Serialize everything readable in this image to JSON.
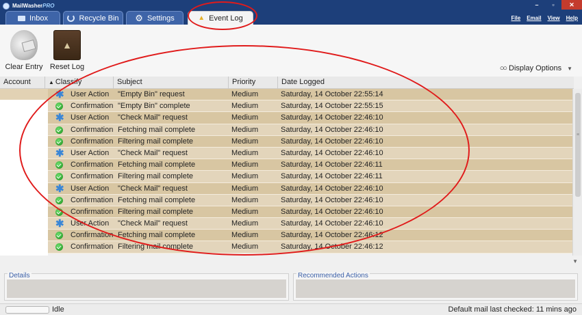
{
  "app": {
    "title_main": "MailWasher",
    "title_suffix": "PRO"
  },
  "window_controls": {
    "minimize": "–",
    "maximize": "▫",
    "close": "✕"
  },
  "tabs": [
    {
      "label": "Inbox",
      "icon": "inbox-icon"
    },
    {
      "label": "Recycle Bin",
      "icon": "recycle-bin-icon"
    },
    {
      "label": "Settings",
      "icon": "gear-icon"
    },
    {
      "label": "Event Log",
      "icon": "warning-icon",
      "active": true
    }
  ],
  "menu": {
    "file": "File",
    "email": "Email",
    "view": "View",
    "help": "Help"
  },
  "toolbar": {
    "clear_entry": "Clear Entry",
    "reset_log": "Reset Log",
    "display_options": "Display Options"
  },
  "columns": {
    "account": "Account",
    "classify": "Classify",
    "subject": "Subject",
    "priority": "Priority",
    "date_logged": "Date Logged"
  },
  "log_rows": [
    {
      "icon": "star",
      "classify": "User Action",
      "subject": "\"Empty Bin\" request",
      "priority": "Medium",
      "date": "Saturday, 14 October 22:55:14"
    },
    {
      "icon": "check",
      "classify": "Confirmation",
      "subject": "\"Empty Bin\" complete",
      "priority": "Medium",
      "date": "Saturday, 14 October 22:55:15"
    },
    {
      "icon": "star",
      "classify": "User Action",
      "subject": "\"Check Mail\" request",
      "priority": "Medium",
      "date": "Saturday, 14 October 22:46:10"
    },
    {
      "icon": "check",
      "classify": "Confirmation",
      "subject": "Fetching mail complete",
      "priority": "Medium",
      "date": "Saturday, 14 October 22:46:10"
    },
    {
      "icon": "check",
      "classify": "Confirmation",
      "subject": "Filtering mail complete",
      "priority": "Medium",
      "date": "Saturday, 14 October 22:46:10"
    },
    {
      "icon": "star",
      "classify": "User Action",
      "subject": "\"Check Mail\" request",
      "priority": "Medium",
      "date": "Saturday, 14 October 22:46:10"
    },
    {
      "icon": "check",
      "classify": "Confirmation",
      "subject": "Fetching mail complete",
      "priority": "Medium",
      "date": "Saturday, 14 October 22:46:11"
    },
    {
      "icon": "check",
      "classify": "Confirmation",
      "subject": "Filtering mail complete",
      "priority": "Medium",
      "date": "Saturday, 14 October 22:46:11"
    },
    {
      "icon": "star",
      "classify": "User Action",
      "subject": "\"Check Mail\" request",
      "priority": "Medium",
      "date": "Saturday, 14 October 22:46:10"
    },
    {
      "icon": "check",
      "classify": "Confirmation",
      "subject": "Fetching mail complete",
      "priority": "Medium",
      "date": "Saturday, 14 October 22:46:10"
    },
    {
      "icon": "check",
      "classify": "Confirmation",
      "subject": "Filtering mail complete",
      "priority": "Medium",
      "date": "Saturday, 14 October 22:46:10"
    },
    {
      "icon": "star",
      "classify": "User Action",
      "subject": "\"Check Mail\" request",
      "priority": "Medium",
      "date": "Saturday, 14 October 22:46:10"
    },
    {
      "icon": "check",
      "classify": "Confirmation",
      "subject": "Fetching mail complete",
      "priority": "Medium",
      "date": "Saturday, 14 October 22:46:12"
    },
    {
      "icon": "check",
      "classify": "Confirmation",
      "subject": "Filtering mail complete",
      "priority": "Medium",
      "date": "Saturday, 14 October 22:46:12"
    }
  ],
  "panes": {
    "details": "Details",
    "recommended": "Recommended Actions"
  },
  "status": {
    "state": "Idle",
    "last_checked": "Default mail last checked: 11 mins ago"
  },
  "colors": {
    "title_bar": "#1d3f7a",
    "row_dark": "#d8c6a2",
    "row_light": "#e3d5bb",
    "annotation": "#e01b1b"
  }
}
